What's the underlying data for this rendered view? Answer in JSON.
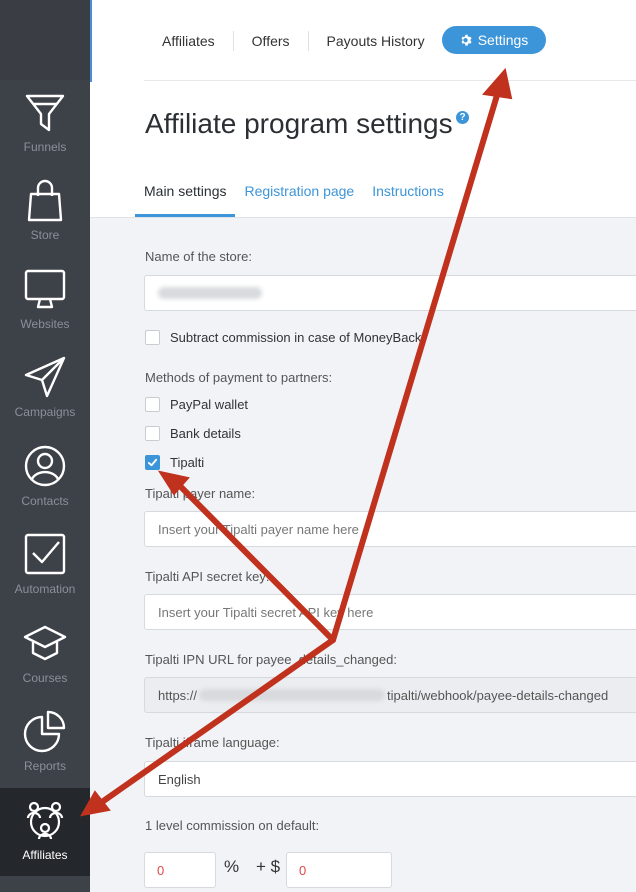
{
  "sidebar": {
    "items": [
      {
        "label": "Funnels",
        "icon": "funnel-icon"
      },
      {
        "label": "Store",
        "icon": "shopping-bag-icon"
      },
      {
        "label": "Websites",
        "icon": "monitor-icon"
      },
      {
        "label": "Campaigns",
        "icon": "paper-plane-icon"
      },
      {
        "label": "Contacts",
        "icon": "user-circle-icon"
      },
      {
        "label": "Automation",
        "icon": "checkbox-icon"
      },
      {
        "label": "Courses",
        "icon": "graduation-cap-icon"
      },
      {
        "label": "Reports",
        "icon": "pie-chart-icon"
      },
      {
        "label": "Affiliates",
        "icon": "affiliates-network-icon"
      }
    ]
  },
  "topnav": {
    "tabs": [
      "Affiliates",
      "Offers",
      "Payouts History"
    ],
    "settings_label": "Settings"
  },
  "page": {
    "title": "Affiliate program settings",
    "help": "?",
    "subtabs": [
      "Main settings",
      "Registration page",
      "Instructions"
    ]
  },
  "form": {
    "store_name_label": "Name of the store:",
    "subtract_label": "Subtract commission in case of MoneyBack",
    "methods_label": "Methods of payment to partners:",
    "methods": [
      {
        "label": "PayPal wallet",
        "checked": false
      },
      {
        "label": "Bank details",
        "checked": false
      },
      {
        "label": "Tipalti",
        "checked": true
      }
    ],
    "payer_name_label": "Tipalti payer name:",
    "payer_name_placeholder": "Insert your Tipalti payer name here",
    "api_key_label": "Tipalti API secret key:",
    "api_key_placeholder": "Insert your Tipalti secret API key here",
    "ipn_label": "Tipalti IPN URL for payee_details_changed:",
    "ipn_prefix": "https://",
    "ipn_suffix": "tipalti/webhook/payee-details-changed",
    "iframe_lang_label": "Tipalti iframe language:",
    "iframe_lang_value": "English",
    "commission_label": "1 level commission on default:",
    "commission_percent": "0",
    "percent_sign": "%",
    "plus_dollar": "+ $",
    "commission_fixed": "0"
  },
  "colors": {
    "accent": "#3d95d9",
    "sidebar": "#3d4148",
    "arrow": "#c0321e"
  }
}
